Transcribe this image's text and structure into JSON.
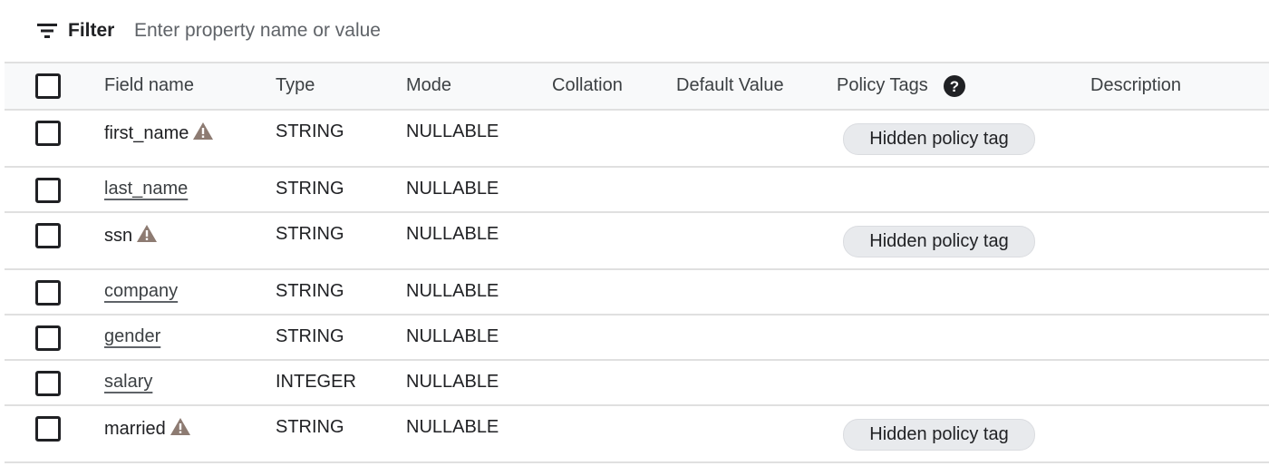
{
  "filter": {
    "label": "Filter",
    "placeholder": "Enter property name or value",
    "icon": "filter-list-icon"
  },
  "table": {
    "headers": {
      "field_name": "Field name",
      "type": "Type",
      "mode": "Mode",
      "collation": "Collation",
      "default_value": "Default Value",
      "policy_tags": "Policy Tags",
      "description": "Description"
    },
    "help_icon": "help-circle-icon",
    "rows": [
      {
        "name": "first_name",
        "type": "STRING",
        "mode": "NULLABLE",
        "warning": true,
        "policy_tag": "Hidden policy tag"
      },
      {
        "name": "last_name",
        "type": "STRING",
        "mode": "NULLABLE",
        "warning": false,
        "policy_tag": ""
      },
      {
        "name": "ssn",
        "type": "STRING",
        "mode": "NULLABLE",
        "warning": true,
        "policy_tag": "Hidden policy tag"
      },
      {
        "name": "company",
        "type": "STRING",
        "mode": "NULLABLE",
        "warning": false,
        "policy_tag": ""
      },
      {
        "name": "gender",
        "type": "STRING",
        "mode": "NULLABLE",
        "warning": false,
        "policy_tag": ""
      },
      {
        "name": "salary",
        "type": "INTEGER",
        "mode": "NULLABLE",
        "warning": false,
        "policy_tag": ""
      },
      {
        "name": "married",
        "type": "STRING",
        "mode": "NULLABLE",
        "warning": true,
        "policy_tag": "Hidden policy tag"
      }
    ]
  },
  "colors": {
    "warning_icon": "#8d7b72",
    "chip_background": "#e8eaed",
    "header_background": "#f8f9fa",
    "border": "#e0e0e0"
  }
}
